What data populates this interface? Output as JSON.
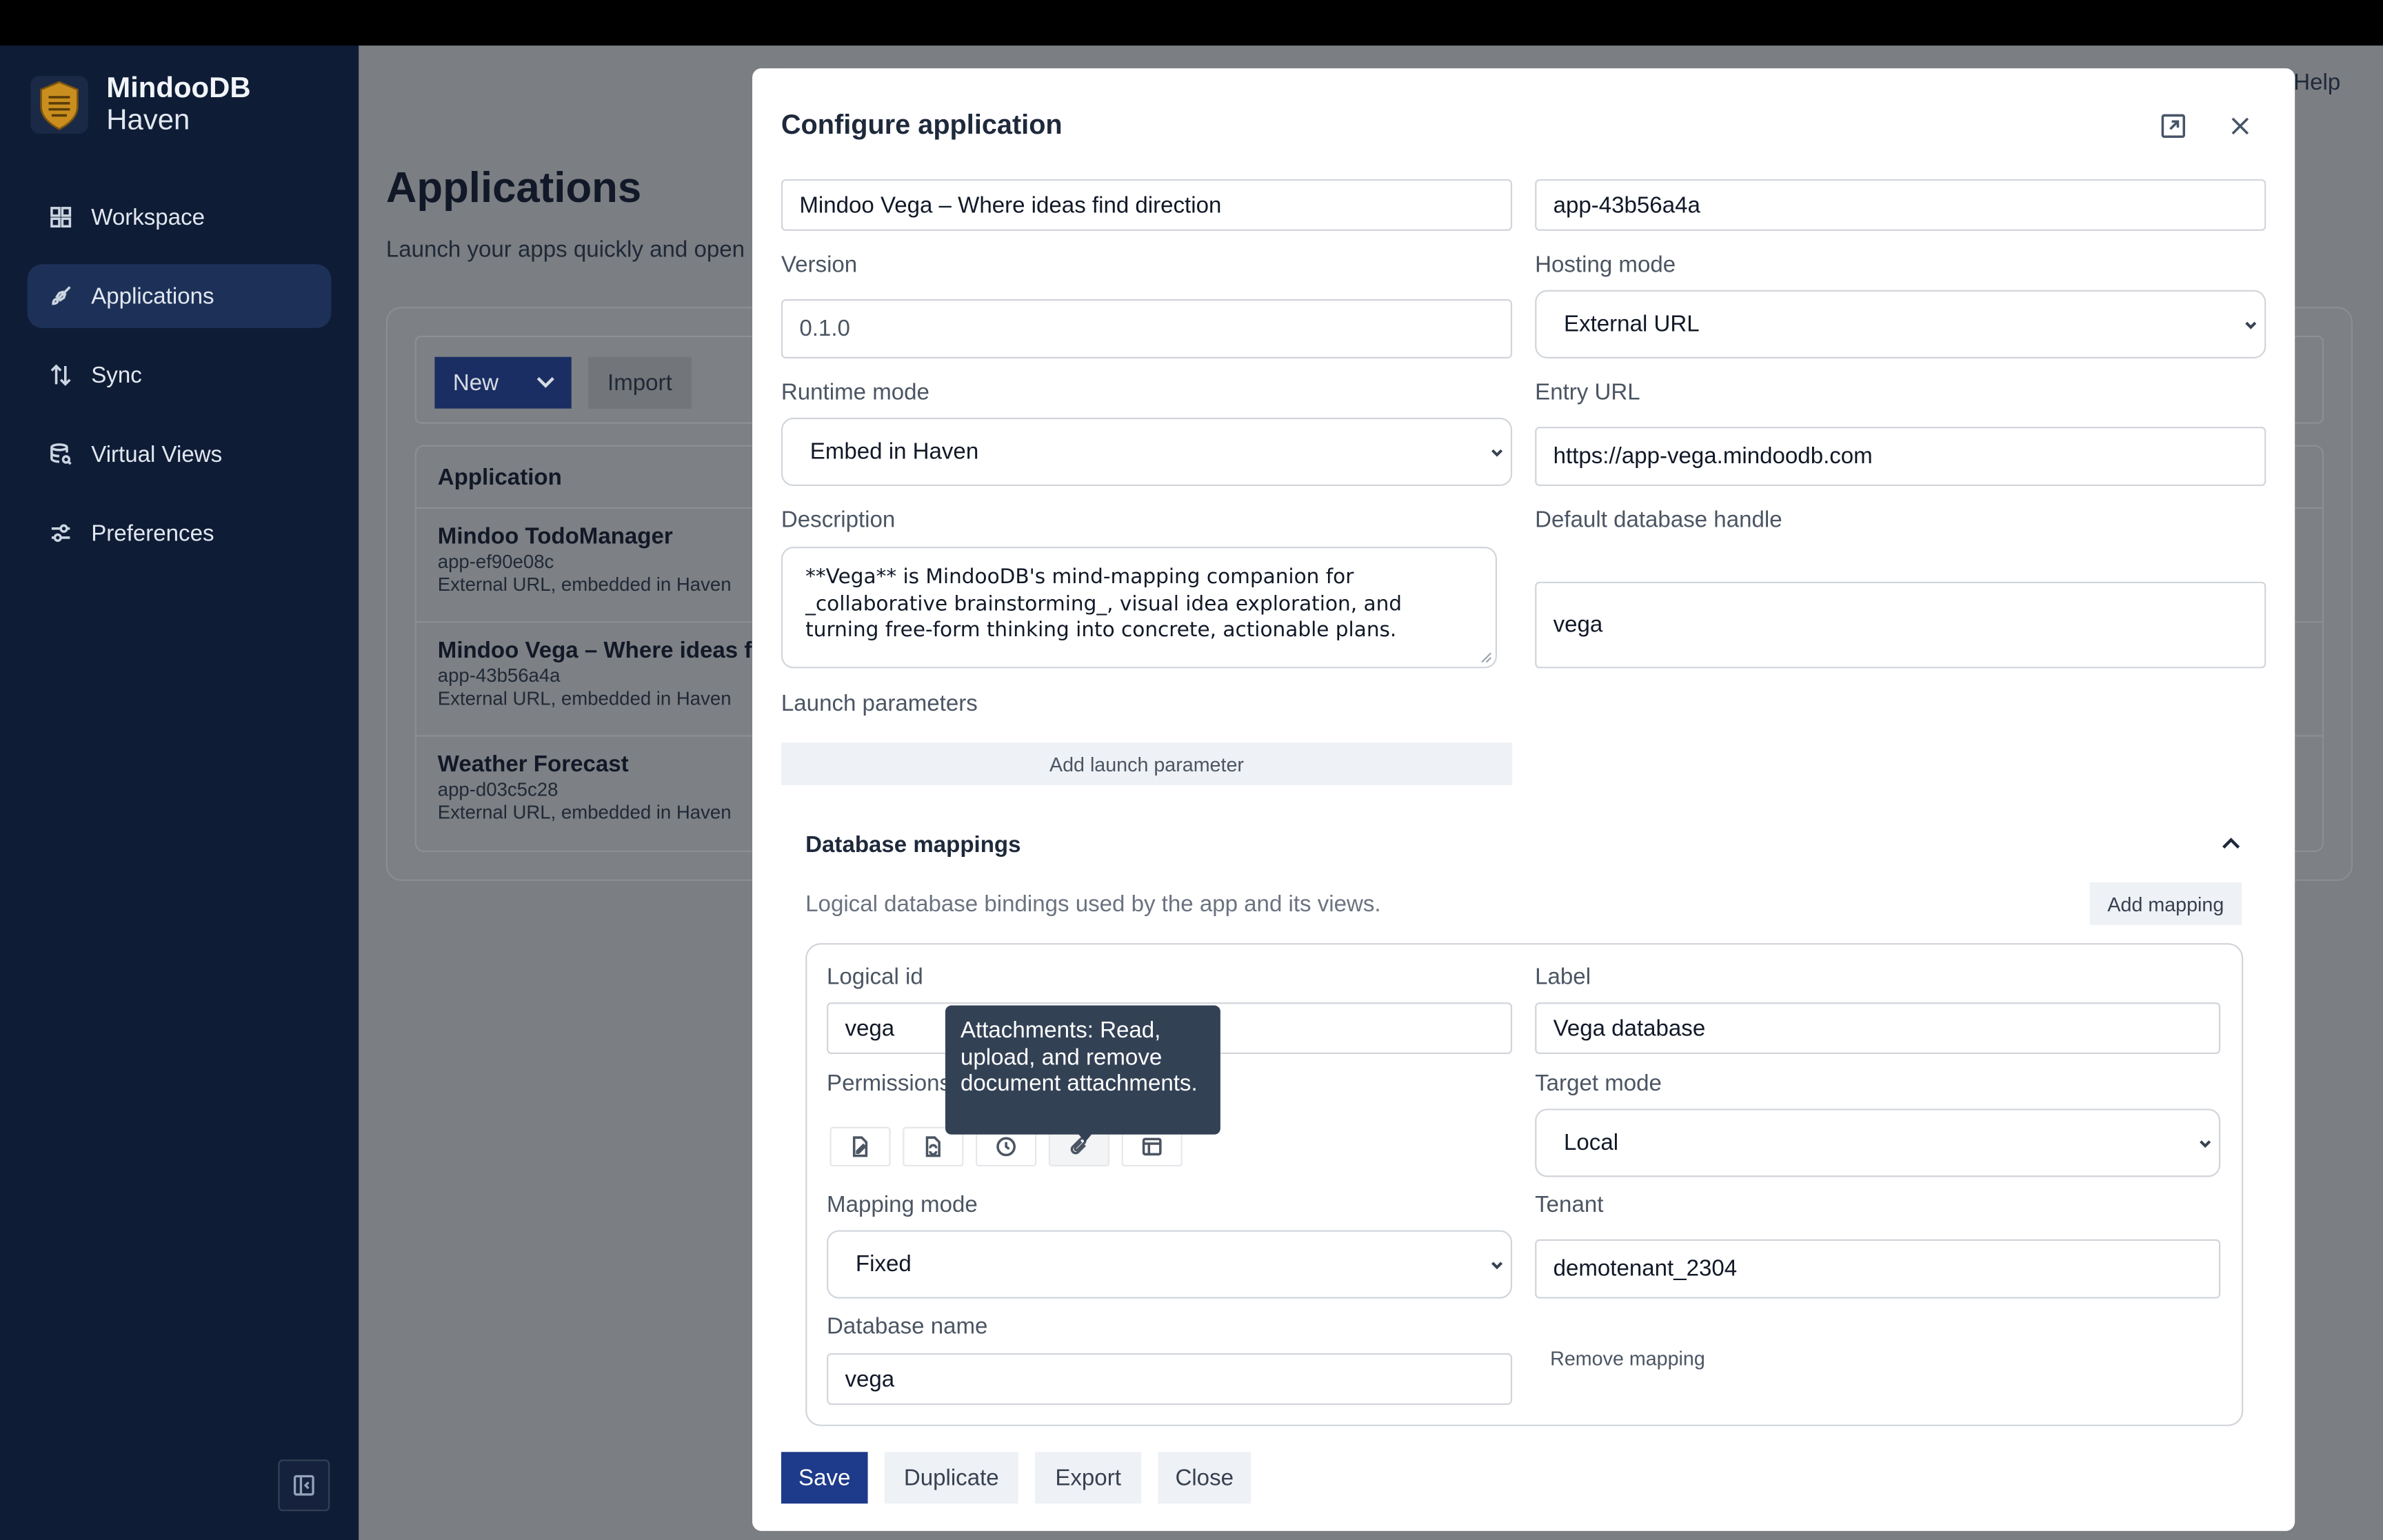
{
  "app": {
    "brand_name": "MindooDB",
    "brand_sub": "Haven"
  },
  "sidebar": {
    "items": [
      {
        "label": "Workspace",
        "icon": "grid-icon"
      },
      {
        "label": "Applications",
        "icon": "rocket-icon",
        "active": true
      },
      {
        "label": "Sync",
        "icon": "sync-arrows-icon"
      },
      {
        "label": "Virtual Views",
        "icon": "database-search-icon"
      },
      {
        "label": "Preferences",
        "icon": "sliders-icon"
      }
    ]
  },
  "header": {
    "help": "Help"
  },
  "page": {
    "title": "Applications",
    "subtitle": "Launch your apps quickly and open",
    "new_label": "New",
    "import_label": "Import",
    "table_header": "Application",
    "rows": [
      {
        "title": "Mindoo TodoManager",
        "id": "app-ef90e08c",
        "meta": "External URL, embedded in Haven"
      },
      {
        "title": "Mindoo Vega – Where ideas find direction",
        "id": "app-43b56a4a",
        "meta": "External URL, embedded in Haven"
      },
      {
        "title": "Weather Forecast",
        "id": "app-d03c5c28",
        "meta": "External URL, embedded in Haven"
      }
    ]
  },
  "modal": {
    "title": "Configure application",
    "name_value": "Mindoo Vega – Where ideas find direction",
    "app_id_value": "app-43b56a4a",
    "version_label": "Version",
    "version_placeholder": "0.1.0",
    "hosting_label": "Hosting mode",
    "hosting_value": "External URL",
    "runtime_label": "Runtime mode",
    "runtime_value": "Embed in Haven",
    "entry_label": "Entry URL",
    "entry_value": "https://app-vega.mindoodb.com",
    "description_label": "Description",
    "description_value": "**Vega** is MindooDB's mind-mapping companion for _collaborative brainstorming_, visual idea exploration, and turning free-form thinking into concrete, actionable plans.",
    "default_db_label": "Default database handle",
    "default_db_value": "vega",
    "launch_params_label": "Launch parameters",
    "add_launch_param": "Add launch parameter",
    "db_mappings": {
      "title": "Database mappings",
      "description": "Logical database bindings used by the app and its views.",
      "add_mapping": "Add mapping",
      "logical_id_label": "Logical id",
      "logical_id_value": "vega",
      "label_label": "Label",
      "label_value": "Vega database",
      "permissions_label": "Permissions",
      "permissions_icons": [
        "file-edit-icon",
        "file-sync-icon",
        "clock-icon",
        "paperclip-icon",
        "table-icon"
      ],
      "tooltip": "Attachments: Read, upload, and remove document attachments.",
      "target_mode_label": "Target mode",
      "target_mode_value": "Local",
      "mapping_mode_label": "Mapping mode",
      "mapping_mode_value": "Fixed",
      "tenant_label": "Tenant",
      "tenant_value": "demotenant_2304",
      "db_name_label": "Database name",
      "db_name_value": "vega",
      "remove_mapping": "Remove mapping"
    },
    "footer": {
      "save": "Save",
      "duplicate": "Duplicate",
      "export": "Export",
      "close": "Close"
    }
  }
}
